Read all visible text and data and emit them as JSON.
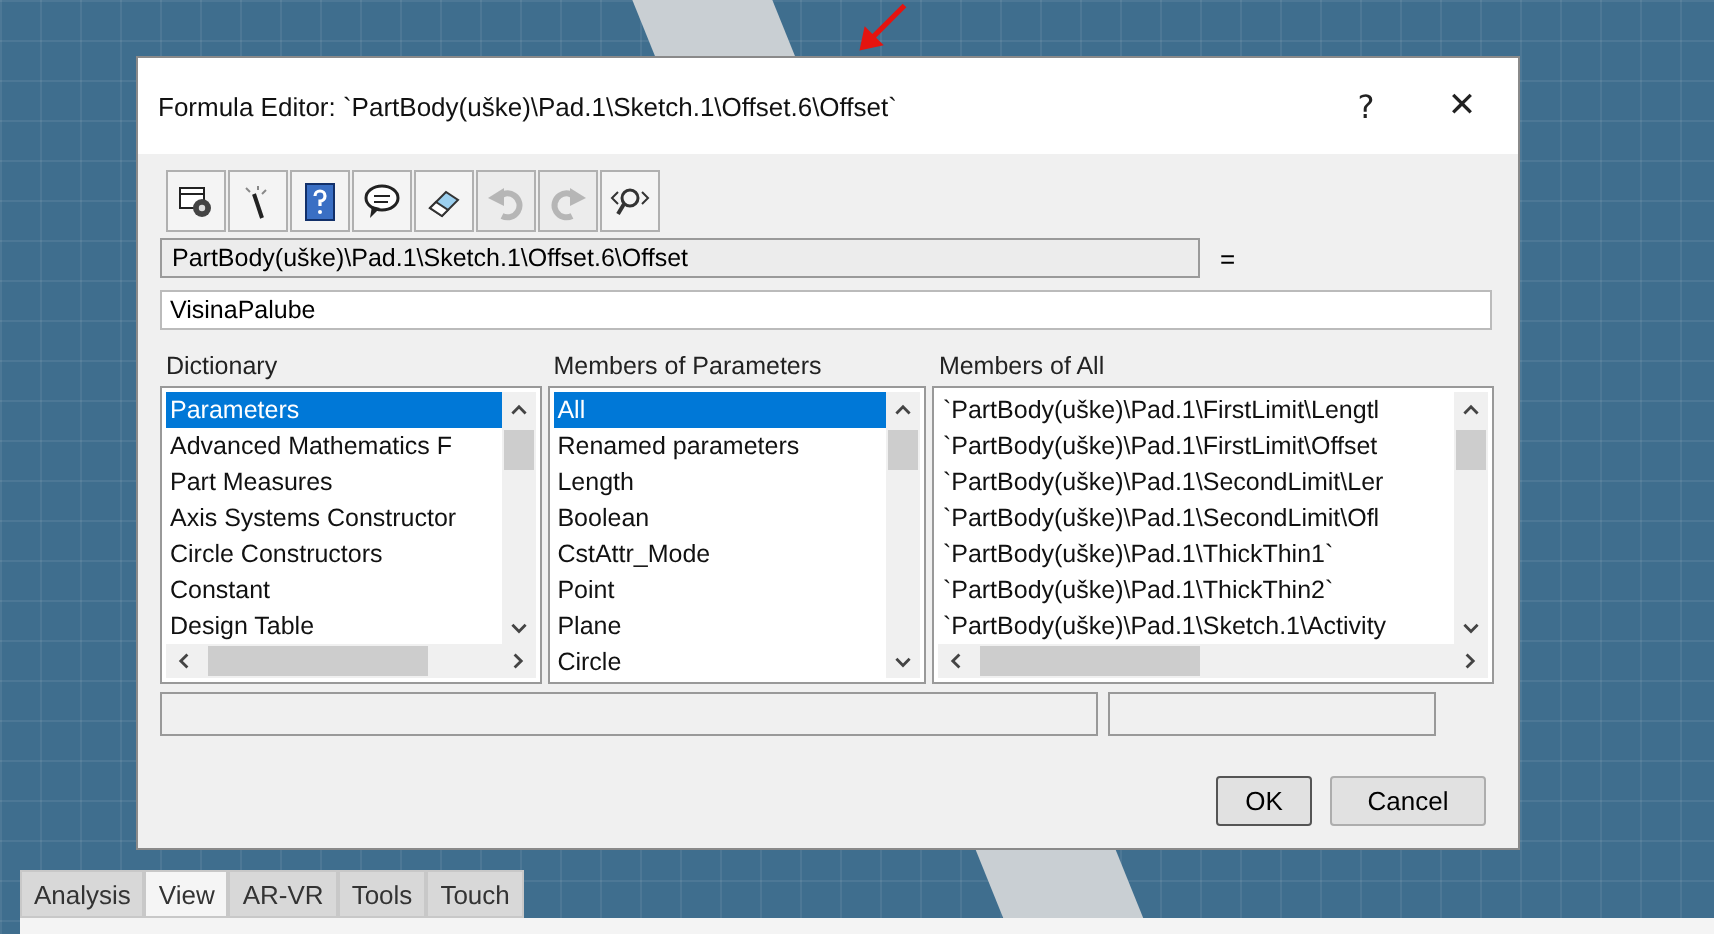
{
  "window": {
    "title": "Formula Editor: `PartBody(uške)\\Pad.1\\Sketch.1\\Offset.6\\Offset`",
    "help": "?",
    "close": "✕"
  },
  "toolbar": [
    {
      "kind": "settings",
      "disabled": false
    },
    {
      "kind": "wand",
      "disabled": false
    },
    {
      "kind": "help",
      "disabled": false
    },
    {
      "kind": "speech",
      "disabled": false
    },
    {
      "kind": "eraser",
      "disabled": false
    },
    {
      "kind": "undo",
      "disabled": true
    },
    {
      "kind": "redo",
      "disabled": true
    },
    {
      "kind": "lookup",
      "disabled": false
    }
  ],
  "parameter_path": "PartBody(uške)\\Pad.1\\Sketch.1\\Offset.6\\Offset",
  "equals": "=",
  "formula": {
    "value": "VisinaPalube"
  },
  "lists": [
    {
      "title": "Dictionary",
      "items": [
        {
          "label": "Parameters",
          "selected": true
        },
        {
          "label": "Advanced Mathematics F",
          "selected": false
        },
        {
          "label": "Part Measures",
          "selected": false
        },
        {
          "label": "Axis Systems Constructor",
          "selected": false
        },
        {
          "label": "Circle Constructors",
          "selected": false
        },
        {
          "label": "Constant",
          "selected": false
        },
        {
          "label": "Design Table",
          "selected": false
        }
      ],
      "horizontal_scroll": true
    },
    {
      "title": "Members of Parameters",
      "items": [
        {
          "label": "All",
          "selected": true
        },
        {
          "label": "Renamed parameters",
          "selected": false
        },
        {
          "label": "Length",
          "selected": false
        },
        {
          "label": "Boolean",
          "selected": false
        },
        {
          "label": "CstAttr_Mode",
          "selected": false
        },
        {
          "label": "Point",
          "selected": false
        },
        {
          "label": "Plane",
          "selected": false
        },
        {
          "label": "Circle",
          "selected": false
        }
      ],
      "horizontal_scroll": false
    },
    {
      "title": "Members of All",
      "items": [
        {
          "label": "`PartBody(uške)\\Pad.1\\FirstLimit\\Lengtl",
          "selected": false
        },
        {
          "label": "`PartBody(uške)\\Pad.1\\FirstLimit\\Offset",
          "selected": false
        },
        {
          "label": "`PartBody(uške)\\Pad.1\\SecondLimit\\Ler",
          "selected": false
        },
        {
          "label": "`PartBody(uške)\\Pad.1\\SecondLimit\\Ofl",
          "selected": false
        },
        {
          "label": "`PartBody(uške)\\Pad.1\\ThickThin1`",
          "selected": false
        },
        {
          "label": "`PartBody(uške)\\Pad.1\\ThickThin2`",
          "selected": false
        },
        {
          "label": "`PartBody(uške)\\Pad.1\\Sketch.1\\Activity",
          "selected": false
        }
      ],
      "horizontal_scroll": true
    }
  ],
  "buttons": [
    "OK",
    "Cancel"
  ],
  "tabs": [
    {
      "label": "Analysis",
      "selected": false
    },
    {
      "label": "View",
      "selected": true
    },
    {
      "label": "AR-VR",
      "selected": false
    },
    {
      "label": "Tools",
      "selected": false
    },
    {
      "label": "Touch",
      "selected": false
    }
  ]
}
